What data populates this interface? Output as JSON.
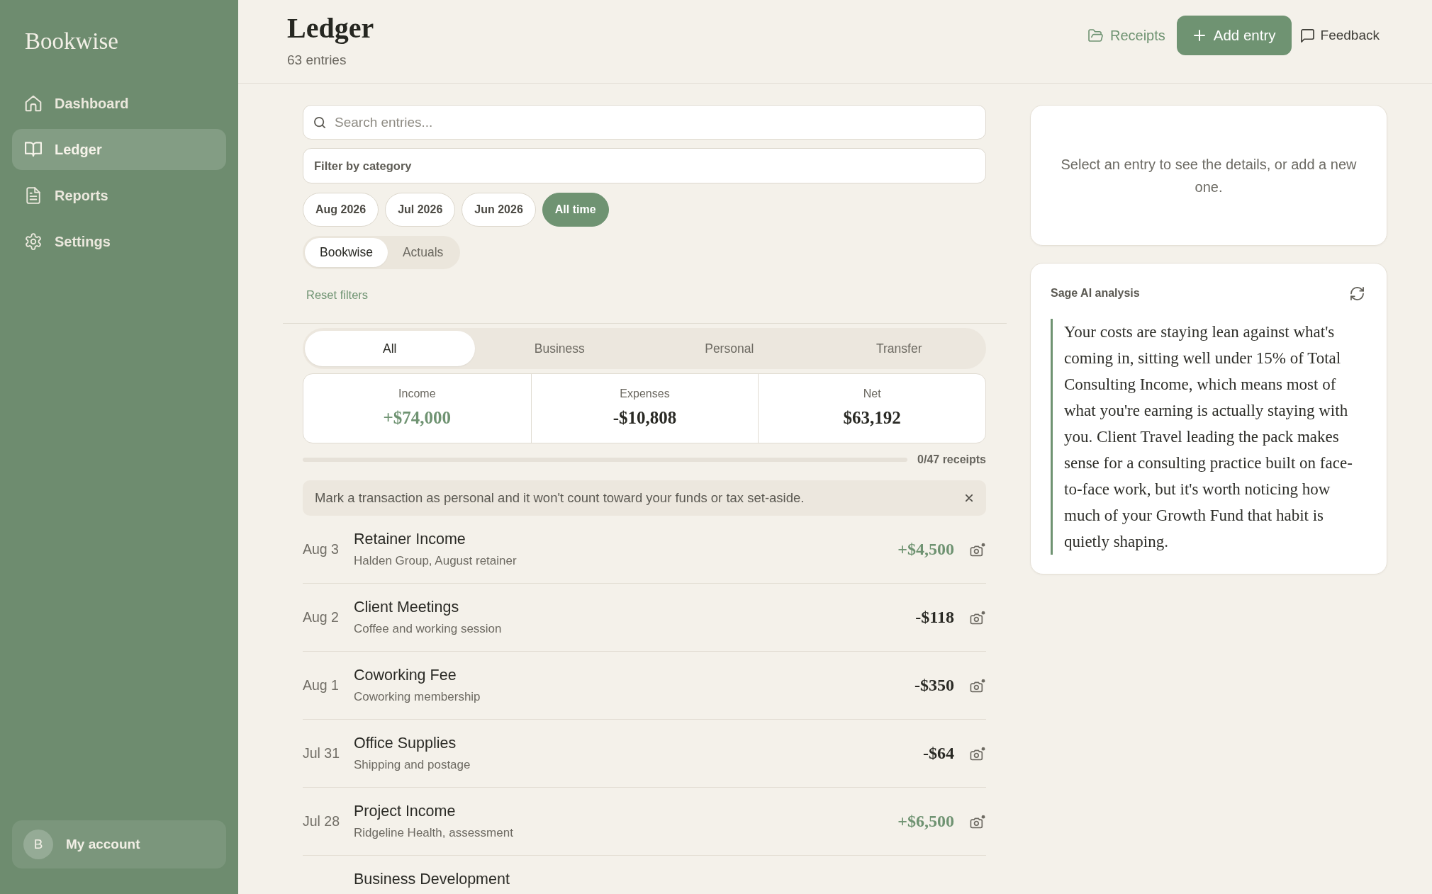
{
  "sidebar": {
    "logo": "Bookwise",
    "items": [
      {
        "label": "Dashboard",
        "selected": false
      },
      {
        "label": "Ledger",
        "selected": true
      },
      {
        "label": "Reports",
        "selected": false
      },
      {
        "label": "Settings",
        "selected": false
      }
    ],
    "account": {
      "initial": "B",
      "label": "My account"
    }
  },
  "header": {
    "title": "Ledger",
    "subtitle": "63 entries",
    "actions": [
      {
        "label": "Receipts",
        "kind": "link"
      },
      {
        "label": "Add entry",
        "kind": "primary"
      },
      {
        "label": "Feedback",
        "kind": "plain"
      }
    ]
  },
  "filters": {
    "search": {
      "placeholder": "Search entries..."
    },
    "category": {
      "placeholder": "Filter by category"
    },
    "periods": [
      {
        "label": "Aug 2026",
        "selected": false
      },
      {
        "label": "Jul 2026",
        "selected": false
      },
      {
        "label": "Jun 2026",
        "selected": false
      },
      {
        "label": "All time",
        "selected": true
      }
    ],
    "sources": [
      {
        "label": "Bookwise",
        "selected": true
      },
      {
        "label": "Actuals",
        "selected": false
      }
    ],
    "reset": "Reset filters"
  },
  "type_tabs": [
    {
      "label": "All",
      "selected": true
    },
    {
      "label": "Business",
      "selected": false
    },
    {
      "label": "Personal",
      "selected": false
    },
    {
      "label": "Transfer",
      "selected": false
    }
  ],
  "summary": [
    {
      "label": "Income",
      "value": "+$74,000",
      "color": "#6f9372"
    },
    {
      "label": "Expenses",
      "value": "-$10,808",
      "color": "#2a2a25"
    },
    {
      "label": "Net",
      "value": "$63,192",
      "color": "#2a2a25"
    }
  ],
  "receipts": {
    "level": 0,
    "reading": "0/47 receipts"
  },
  "notice": {
    "text": "Mark a transaction as personal and it won't count toward your funds or tax set-aside."
  },
  "entries": [
    {
      "date": "Aug 3",
      "title": "Retainer Income",
      "note": "Halden Group, August retainer",
      "amount": "+$4,500",
      "color": "#6f9372"
    },
    {
      "date": "Aug 2",
      "title": "Client Meetings",
      "note": "Coffee and working session",
      "amount": "-$118",
      "color": "#2a2a25"
    },
    {
      "date": "Aug 1",
      "title": "Coworking Fee",
      "note": "Coworking membership",
      "amount": "-$350",
      "color": "#2a2a25"
    },
    {
      "date": "Jul 31",
      "title": "Office Supplies",
      "note": "Shipping and postage",
      "amount": "-$64",
      "color": "#2a2a25"
    },
    {
      "date": "Jul 28",
      "title": "Project Income",
      "note": "Ridgeline Health, assessment",
      "amount": "+$6,500",
      "color": "#6f9372"
    },
    {
      "title": "Business Development"
    }
  ],
  "detail": {
    "message": "Select an entry to see the details, or add a new one."
  },
  "analysis": {
    "title": "Sage AI analysis",
    "text": "Your costs are staying lean against what's coming in, sitting well under 15% of Total Consulting Income, which means most of what you're earning is actually staying with you. Client Travel leading the pack makes sense for a consulting practice built on face-to-face work, but it's worth noticing how much of your Growth Fund that habit is quietly shaping."
  }
}
